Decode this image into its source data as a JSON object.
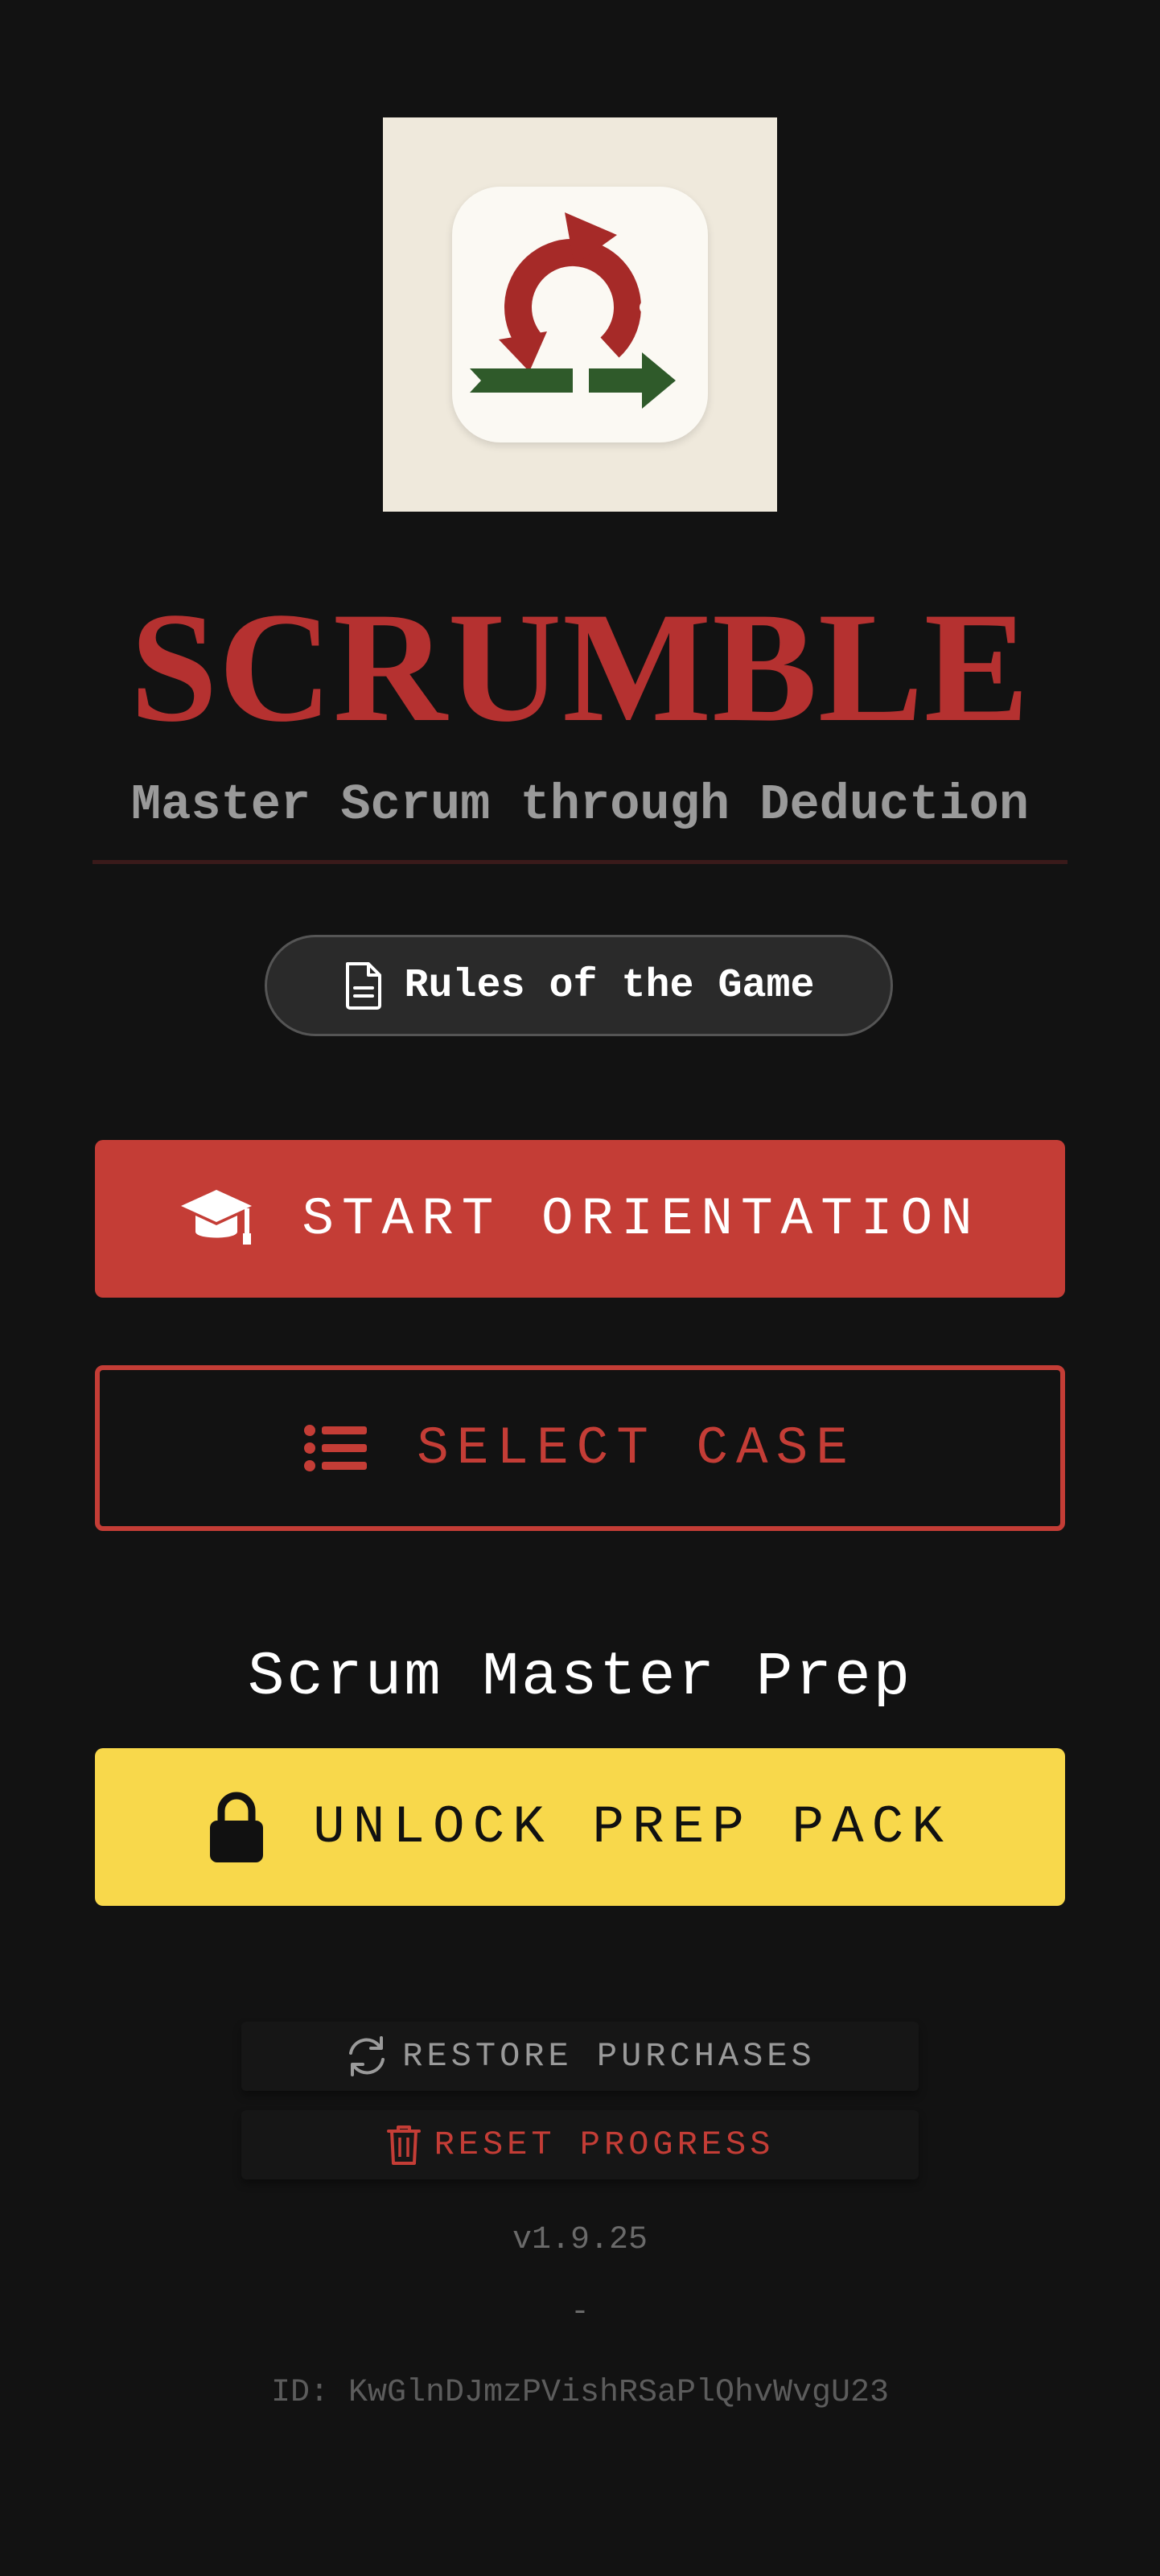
{
  "app": {
    "title": "SCRUMBLE",
    "subtitle": "Master Scrum through Deduction"
  },
  "rules": {
    "label": "Rules of the Game",
    "icon": "document-icon"
  },
  "actions": {
    "start_orientation": {
      "label": "START ORIENTATION",
      "icon": "graduation-cap-icon"
    },
    "select_case": {
      "label": "SELECT CASE",
      "icon": "list-icon"
    }
  },
  "prep": {
    "heading": "Scrum Master Prep",
    "unlock_label": "UNLOCK PREP PACK",
    "icon": "lock-icon"
  },
  "secondary": {
    "restore_label": "RESTORE PURCHASES",
    "restore_icon": "refresh-icon",
    "reset_label": "RESET PROGRESS",
    "reset_icon": "trash-icon"
  },
  "footer": {
    "version": "v1.9.25",
    "separator": "-",
    "device_id": "ID: KwGlnDJmzPVishRSaPlQhvWvgU23"
  },
  "colors": {
    "background": "#121212",
    "accent_red": "#c43d36",
    "title_red": "#b53130",
    "accent_yellow": "#f8d84b",
    "logo_green": "#2f5a2a"
  }
}
